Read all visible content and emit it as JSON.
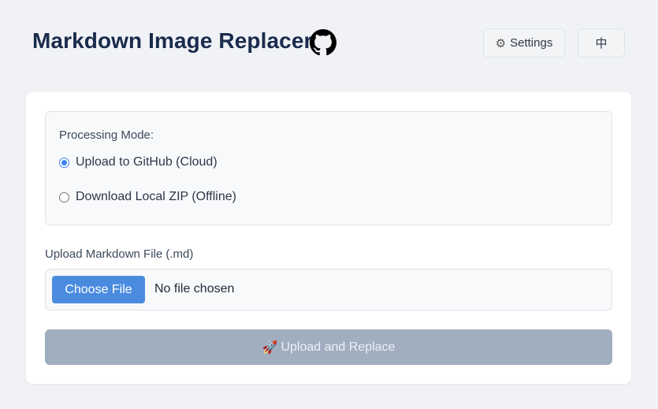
{
  "header": {
    "title": "Markdown Image Replacer",
    "github_icon": "github-icon",
    "settings_label": "Settings",
    "settings_icon": "gear-icon",
    "language_label": "中"
  },
  "mode": {
    "label": "Processing Mode:",
    "options": [
      {
        "label": "Upload to GitHub (Cloud)",
        "selected": true
      },
      {
        "label": "Download Local ZIP (Offline)",
        "selected": false
      }
    ]
  },
  "file": {
    "label": "Upload Markdown File (.md)",
    "button_label": "Choose File",
    "status": "No file chosen"
  },
  "submit": {
    "icon": "🚀",
    "label": "Upload and Replace",
    "disabled": true
  },
  "colors": {
    "accent": "#4a8be0",
    "title": "#1a2b4c",
    "disabled": "#a0aec0",
    "background": "#f0f2f6"
  }
}
